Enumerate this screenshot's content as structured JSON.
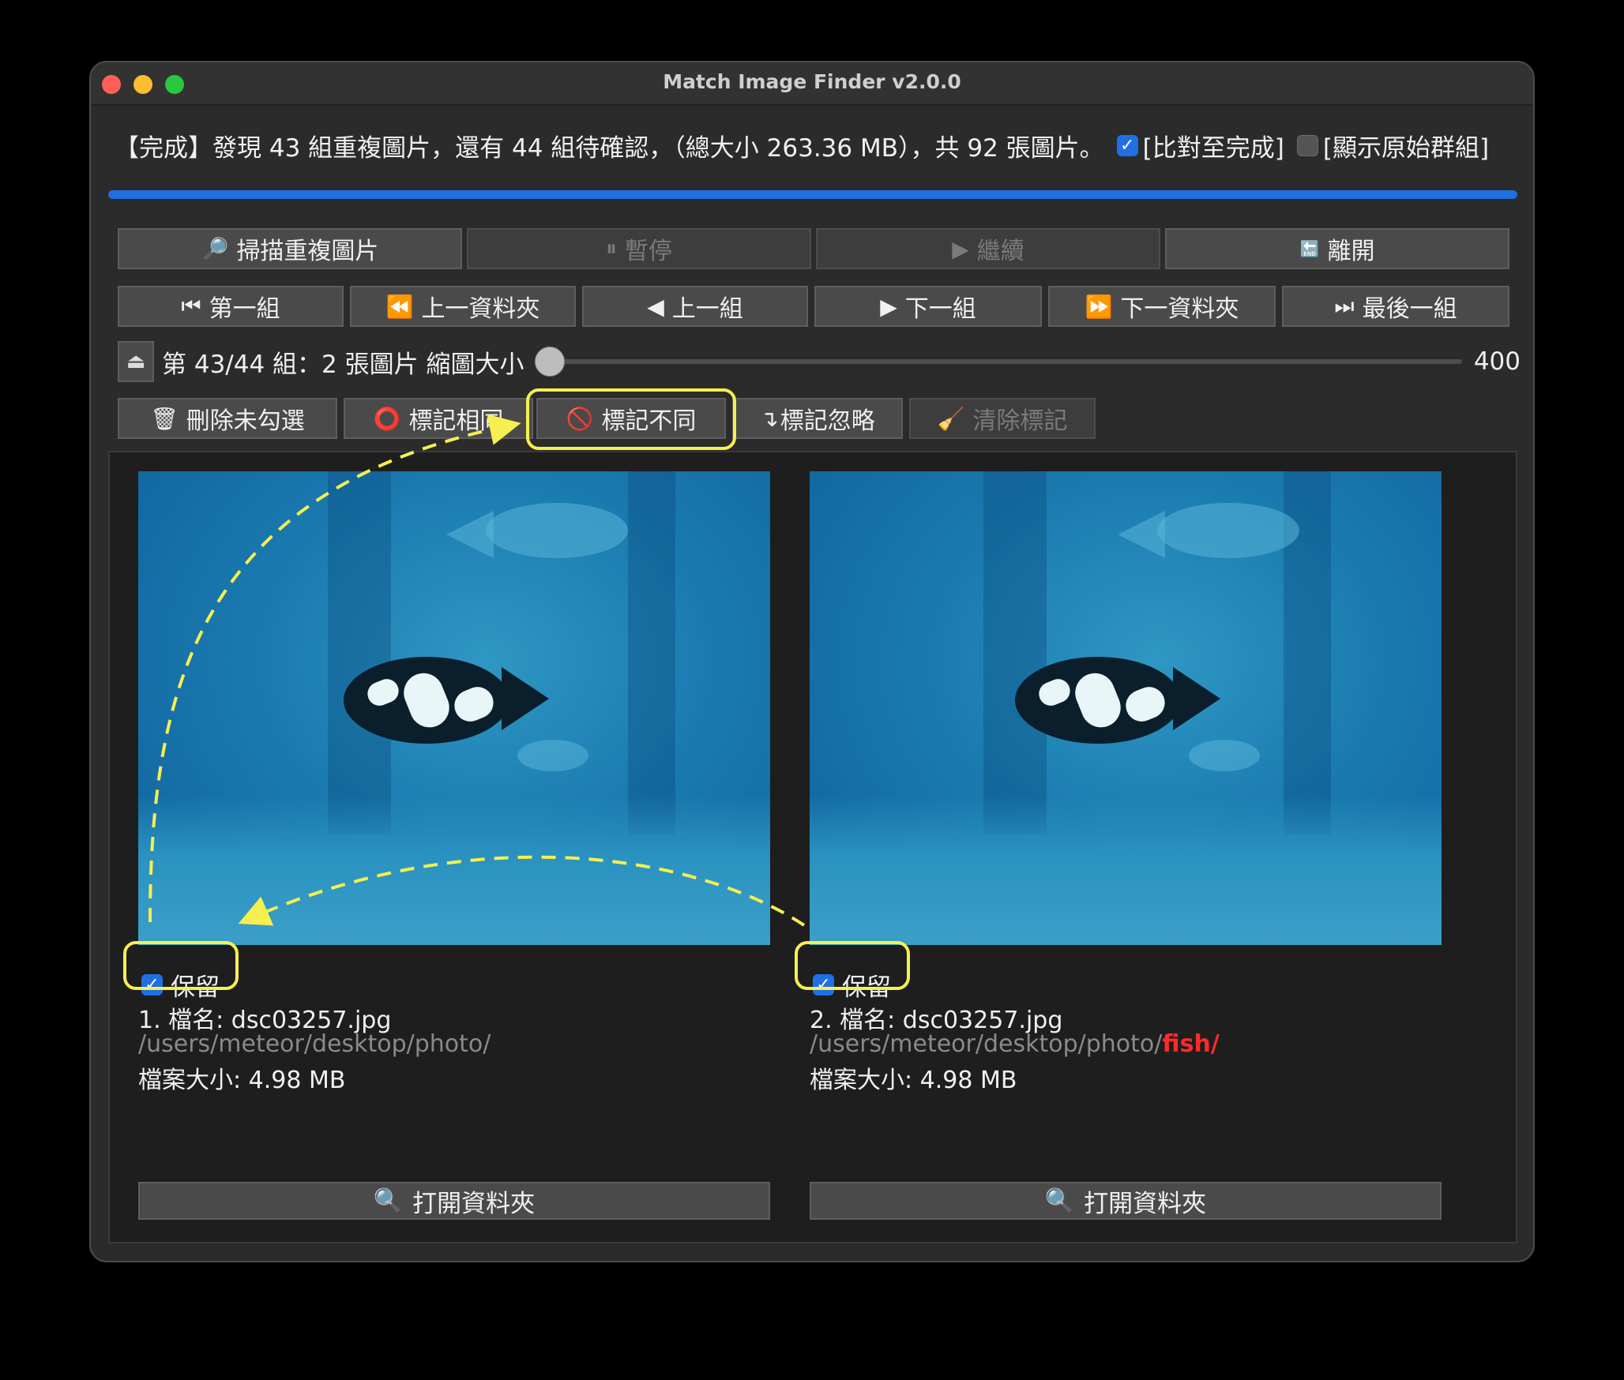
{
  "window": {
    "title": "Match Image Finder v2.0.0"
  },
  "status": {
    "text": "【完成】發現 43 組重複圖片，還有 44 組待確認，（總大小 263.36 MB），共 92 張圖片。",
    "compare_to_end_label": "[比對至完成]",
    "compare_to_end_checked": true,
    "show_original_group_label": "[顯示原始群組]",
    "show_original_group_checked": false,
    "progress_fraction": 1.0
  },
  "toolbar1": {
    "scan": {
      "label": "掃描重複圖片",
      "icon": "magnifier-icon"
    },
    "pause": {
      "label": "暫停",
      "icon": "pause-icon"
    },
    "resume": {
      "label": "繼續",
      "icon": "play-icon"
    },
    "exit": {
      "label": "離開",
      "icon": "end-icon"
    }
  },
  "toolbar2": {
    "first_group": {
      "label": "第一組",
      "icon": "⏮"
    },
    "prev_folder": {
      "label": "上一資料夾",
      "icon": "⏪"
    },
    "prev_group": {
      "label": "上一組",
      "icon": "◀"
    },
    "next_group": {
      "label": "下一組",
      "icon": "▶"
    },
    "next_folder": {
      "label": "下一資料夾",
      "icon": "⏩"
    },
    "last_group": {
      "label": "最後一組",
      "icon": "⏭"
    }
  },
  "group_info": {
    "label": "第 43/44 組：2 張圖片 縮圖大小",
    "collapse_icon": "⏏",
    "thumbnail_size": "400"
  },
  "actions": {
    "delete_unchecked": {
      "label": "刪除未勾選",
      "icon": "trash-icon"
    },
    "mark_same": {
      "label": "標記相同",
      "icon": "circle-icon"
    },
    "mark_different": {
      "label": "標記不同",
      "icon": "prohibited-icon"
    },
    "mark_ignore": {
      "label": "標記忽略",
      "icon": "↴"
    },
    "clear_marks": {
      "label": "清除標記",
      "icon": "broom-icon"
    }
  },
  "images": [
    {
      "keep_label": "保留",
      "keep_checked": true,
      "name_line": "1. 檔名: dsc03257.jpg",
      "path": "/users/meteor/desktop/photo/",
      "path_diff": "",
      "size_line": "檔案大小: 4.98 MB",
      "open_folder_label": "打開資料夾"
    },
    {
      "keep_label": "保留",
      "keep_checked": true,
      "name_line": "2. 檔名: dsc03257.jpg",
      "path": "/users/meteor/desktop/photo/",
      "path_diff": "fish/",
      "size_line": "檔案大小: 4.98 MB",
      "open_folder_label": "打開資料夾"
    }
  ],
  "colors": {
    "accent": "#1e6fe0",
    "highlight": "#f5f050",
    "path_diff": "#ff2a2a"
  }
}
